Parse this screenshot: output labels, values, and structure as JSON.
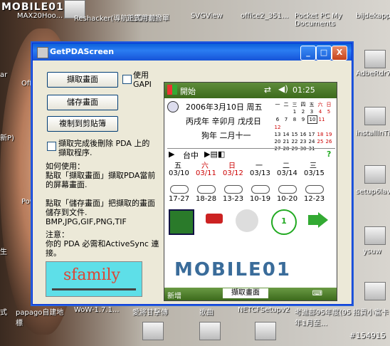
{
  "desktop": {
    "watermark_logo": "MOBILE01",
    "watermark_num": "#154915",
    "labels_top": [
      "MAX20Hoo...",
      "Reshacker(導航地圖修改)",
      "正式用劃撥單",
      "SVGView",
      "office2_351...",
      "Pocket PC My Documents",
      "bijdekapp"
    ],
    "labels_right": [
      "AdbeRdr70",
      "installInThe",
      "setup6lav",
      "ysuw",
      "招貢小富卡"
    ],
    "labels_bottom": [
      "式",
      "papago自建地標",
      "WoW-1.7.1...",
      "愛將甘擊傳",
      "歌曲",
      "NETCFSetupv2",
      "考進部95年度(95年1月至...",
      "招貢小富卡"
    ],
    "labels_left": [
      "ar",
      "Offi",
      "新P)",
      "Pow",
      "生"
    ]
  },
  "window": {
    "title": "GetPDAScreen",
    "min_label": "_",
    "max_label": "□",
    "close_label": "X",
    "capture_button": "擷取畫面",
    "use_gapi_label": "使用GAPI",
    "save_button": "儲存畫面",
    "copy_button": "複制到剪貼簿",
    "delete_option": "擷取完成後刪除 PDA 上的擷取程序.",
    "howto": "如何使用：\n點取「擷取畫面」擷取PDA當前的屏幕畫面.\n\n點取「儲存畫面」把擷取的畫面儲存到文件.\nBMP,JPG,GIF,PNG,TIF",
    "note": "注意：\n你的 PDA 必需和ActiveSync 連接。",
    "sfamily": "sfamily"
  },
  "pda": {
    "start": "開始",
    "time": "01:25",
    "date_line1": "2006年3月10日 周五",
    "date_line2": "丙戌年 辛卯月 戊戌日",
    "date_line3": "狗年 二月十一",
    "city": "台中",
    "question": "?",
    "weekdays": [
      "五",
      "六",
      "日",
      "一",
      "二",
      "三"
    ],
    "dates": [
      "03/10",
      "03/11",
      "03/12",
      "03/13",
      "03/14",
      "03/15"
    ],
    "temps": [
      "17-27",
      "18-28",
      "13-23",
      "10-19",
      "10-20",
      "12-23"
    ],
    "cal_header": [
      "一",
      "二",
      "三",
      "四",
      "五",
      "六",
      "日"
    ],
    "cal_rows": [
      [
        "",
        "",
        "1",
        "2",
        "3",
        "4",
        "5"
      ],
      [
        "6",
        "7",
        "8",
        "9",
        "10",
        "11",
        "12"
      ],
      [
        "13",
        "14",
        "15",
        "16",
        "17",
        "18",
        "19"
      ],
      [
        "20",
        "21",
        "22",
        "23",
        "24",
        "25",
        "26"
      ],
      [
        "27",
        "28",
        "29",
        "30",
        "31",
        "",
        ""
      ]
    ],
    "logo_text": "MOBILE01",
    "left_soft": "新增",
    "softkey": "擷取畫面"
  },
  "colors": {
    "title_blue": "#0a5fd8",
    "pda_green": "#3c6a1c",
    "weekend_red": "#cc0000",
    "sfamily_bg": "#5edfe8"
  }
}
